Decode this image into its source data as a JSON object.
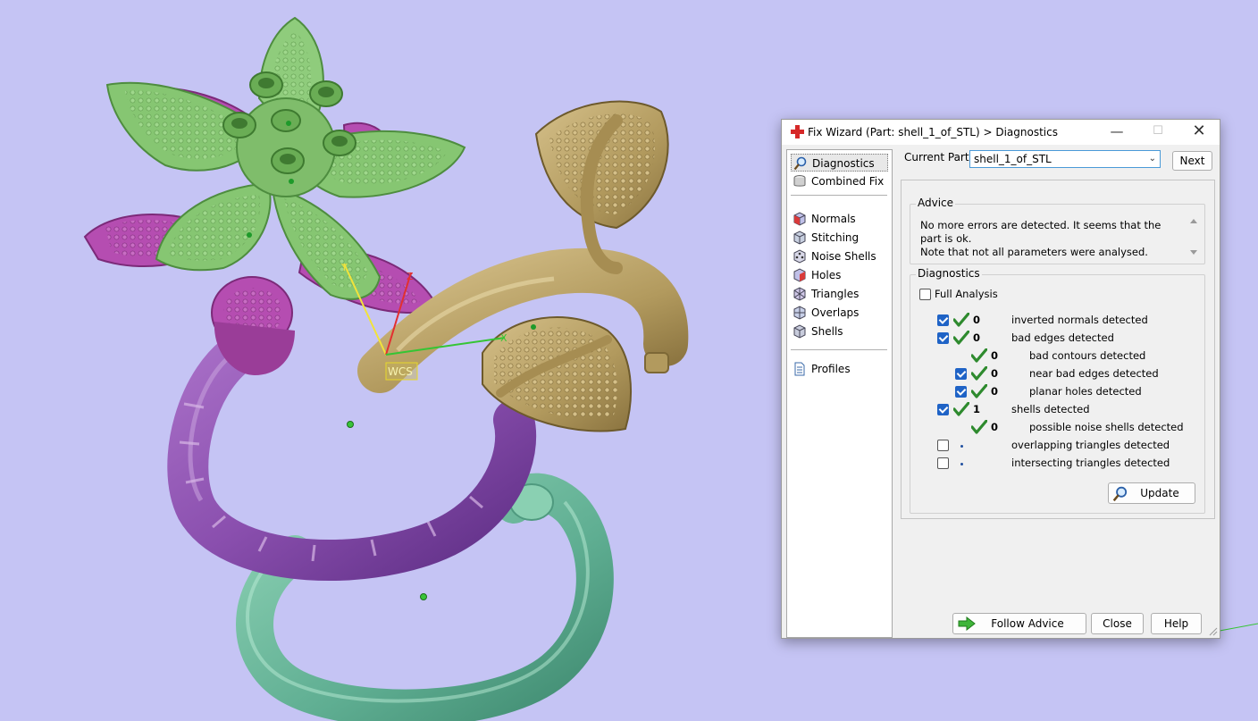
{
  "viewport": {
    "wcs_label": "WCS",
    "axis_labels": {
      "x": "X",
      "y": "Y",
      "z": "Z"
    },
    "colors": {
      "background": "#c5c4f4",
      "flower_green": "#7fbe6c",
      "flower_magenta": "#b24aae",
      "gold": "#b9a064",
      "band_purple": "#8f55ad",
      "band_teal": "#6bb39a"
    }
  },
  "dialog": {
    "title": "Fix Wizard (Part: shell_1_of_STL) > Diagnostics",
    "window_controls": {
      "minimize": "—",
      "maximize": "☐",
      "close": "✕"
    },
    "nav": {
      "items": [
        {
          "label": "Diagnostics",
          "icon": "magnifier-icon",
          "selected": true
        },
        {
          "label": "Combined Fix",
          "icon": "part-icon"
        },
        {
          "label": "Normals",
          "icon": "normals-cube-icon"
        },
        {
          "label": "Stitching",
          "icon": "stitching-icon"
        },
        {
          "label": "Noise Shells",
          "icon": "noise-shells-icon"
        },
        {
          "label": "Holes",
          "icon": "holes-icon"
        },
        {
          "label": "Triangles",
          "icon": "triangles-icon"
        },
        {
          "label": "Overlaps",
          "icon": "overlaps-icon"
        },
        {
          "label": "Shells",
          "icon": "shells-icon"
        },
        {
          "label": "Profiles",
          "icon": "document-icon"
        }
      ]
    },
    "current_part_label": "Current Part:",
    "current_part_value": "shell_1_of_STL",
    "next_label": "Next",
    "advice": {
      "title": "Advice",
      "line1": "No more errors are detected. It seems that the part is ok.",
      "line2": "Note that not all parameters were analysed."
    },
    "diagnostics": {
      "title": "Diagnostics",
      "full_analysis_label": "Full Analysis",
      "full_analysis_checked": false,
      "rows": [
        {
          "checkbox": true,
          "checked": true,
          "ok": true,
          "count": "0",
          "label": "inverted normals detected",
          "indent": 0
        },
        {
          "checkbox": true,
          "checked": true,
          "ok": true,
          "count": "0",
          "label": "bad edges detected",
          "indent": 0
        },
        {
          "checkbox": false,
          "checked": false,
          "ok": true,
          "count": "0",
          "label": "bad contours detected",
          "indent": 1
        },
        {
          "checkbox": true,
          "checked": true,
          "ok": true,
          "count": "0",
          "label": "near bad edges detected",
          "indent": 1
        },
        {
          "checkbox": true,
          "checked": true,
          "ok": true,
          "count": "0",
          "label": "planar holes detected",
          "indent": 1
        },
        {
          "checkbox": true,
          "checked": true,
          "ok": true,
          "count": "1",
          "label": "shells detected",
          "indent": 0
        },
        {
          "checkbox": false,
          "checked": false,
          "ok": true,
          "count": "0",
          "label": "possible noise shells detected",
          "indent": 1
        },
        {
          "checkbox": true,
          "checked": false,
          "ok": false,
          "count": "",
          "label": "overlapping triangles detected",
          "indent": 0
        },
        {
          "checkbox": true,
          "checked": false,
          "ok": false,
          "count": "",
          "label": "intersecting triangles detected",
          "indent": 0
        }
      ],
      "update_label": "Update"
    },
    "footer": {
      "follow_advice_label": "Follow Advice",
      "close_label": "Close",
      "help_label": "Help"
    },
    "colors": {
      "accent": "#1f63c6",
      "ok_green": "#2e8a2e"
    }
  }
}
